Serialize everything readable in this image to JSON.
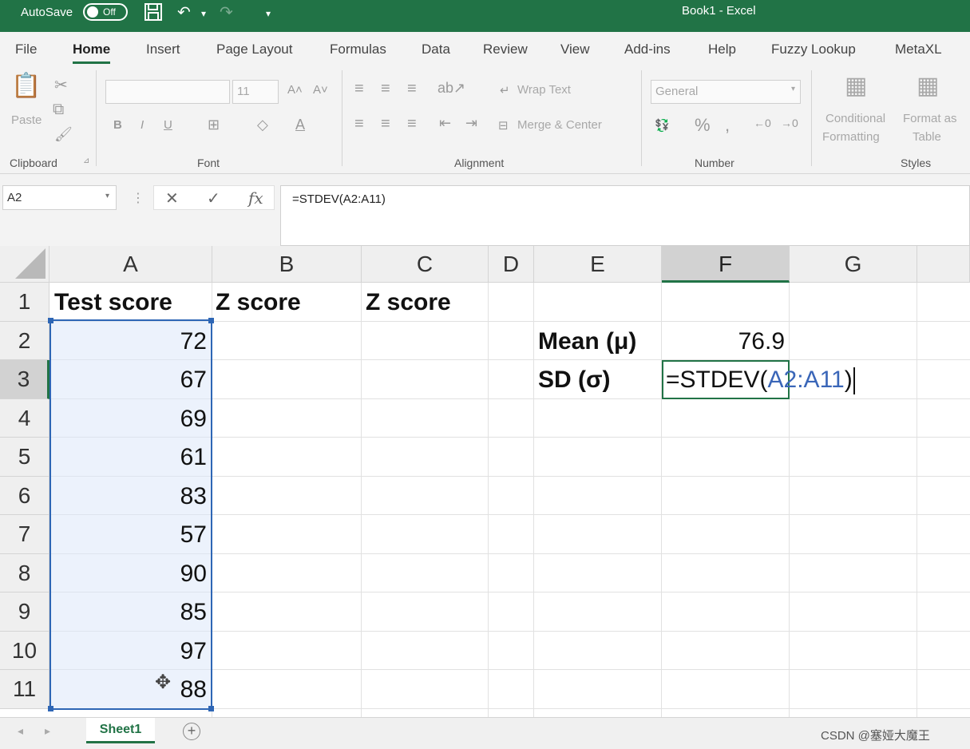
{
  "titlebar": {
    "autosave_label": "AutoSave",
    "autosave_state": "Off",
    "title": "Book1  -  Excel"
  },
  "tabs": [
    "File",
    "Home",
    "Insert",
    "Page Layout",
    "Formulas",
    "Data",
    "Review",
    "View",
    "Add-ins",
    "Help",
    "Fuzzy Lookup",
    "MetaXL"
  ],
  "ribbon": {
    "clipboard": {
      "paste": "Paste",
      "label": "Clipboard"
    },
    "font": {
      "size": "11",
      "bold": "B",
      "italic": "I",
      "underline": "U",
      "label": "Font"
    },
    "alignment": {
      "wrap_text": "Wrap Text",
      "merge_center": "Merge & Center",
      "label": "Alignment"
    },
    "number": {
      "format": "General",
      "percent": "%",
      "label": "Number"
    },
    "styles": {
      "conditional_1": "Conditional",
      "conditional_2": "Formatting",
      "format_as_1": "Format as",
      "format_as_2": "Table",
      "label": "Styles"
    }
  },
  "formula_bar": {
    "name_box": "A2",
    "cancel": "✕",
    "enter": "✓",
    "fx": "fx",
    "formula": "=STDEV(A2:A11)"
  },
  "columns": [
    "A",
    "B",
    "C",
    "D",
    "E",
    "F",
    "G"
  ],
  "rows": [
    "1",
    "2",
    "3",
    "4",
    "5",
    "6",
    "7",
    "8",
    "9",
    "10",
    "11"
  ],
  "cells": {
    "A1": "Test score",
    "B1": "Z score",
    "C1": "Z score",
    "A_values": [
      "72",
      "67",
      "69",
      "61",
      "83",
      "57",
      "90",
      "85",
      "97",
      "88"
    ],
    "E2": "Mean (μ)",
    "F2": "76.9",
    "E3": "SD (σ)",
    "F3_prefix": "=STDEV(",
    "F3_ref": "A2:A11",
    "F3_suffix": ")"
  },
  "sheets": {
    "active": "Sheet1",
    "add": "+"
  },
  "watermark": "CSDN @塞娅大魔王",
  "colors": {
    "excel_green": "#217346",
    "range_blue": "#2e66b5"
  }
}
